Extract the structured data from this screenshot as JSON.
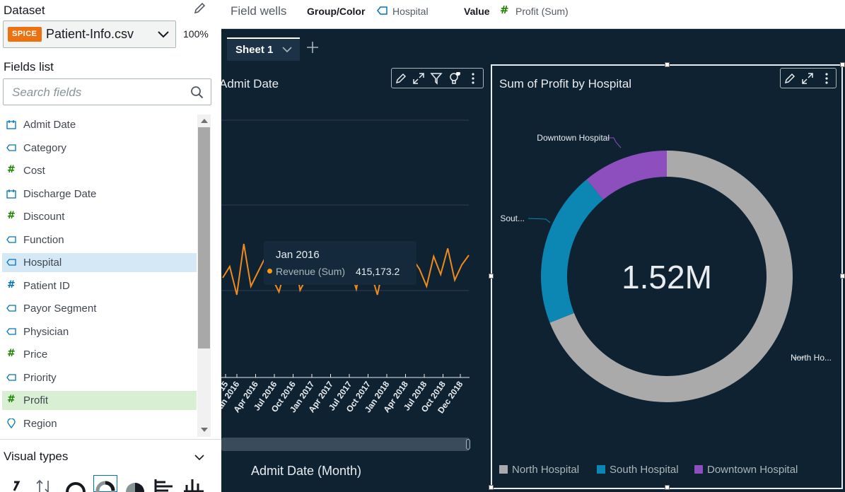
{
  "dataset": {
    "label": "Dataset",
    "badge": "SPICE",
    "name": "Patient-Info.csv",
    "percent": "100%"
  },
  "fields_list": {
    "label": "Fields list",
    "search_placeholder": "Search fields",
    "items": [
      {
        "label": "Admit Date",
        "type": "date"
      },
      {
        "label": "Category",
        "type": "dimension"
      },
      {
        "label": "Cost",
        "type": "measure"
      },
      {
        "label": "Discharge Date",
        "type": "date"
      },
      {
        "label": "Discount",
        "type": "measure"
      },
      {
        "label": "Function",
        "type": "dimension"
      },
      {
        "label": "Hospital",
        "type": "dimension"
      },
      {
        "label": "Patient ID",
        "type": "measure-id"
      },
      {
        "label": "Payor Segment",
        "type": "dimension"
      },
      {
        "label": "Physician",
        "type": "dimension"
      },
      {
        "label": "Price",
        "type": "measure"
      },
      {
        "label": "Priority",
        "type": "dimension"
      },
      {
        "label": "Profit",
        "type": "measure"
      },
      {
        "label": "Region",
        "type": "geo"
      }
    ]
  },
  "visual_types": {
    "label": "Visual types"
  },
  "field_wells": {
    "title": "Field wells",
    "group_color_label": "Group/Color",
    "group_color_value": "Hospital",
    "value_label": "Value",
    "value_value": "Profit (Sum)"
  },
  "sheet": {
    "tab_label": "Sheet 1"
  },
  "line_visual": {
    "title": "Admit Date",
    "x_axis_title": "Admit Date (Month)",
    "x_tick_labels": [
      "15",
      "Jan 2016",
      "Apr 2016",
      "Jul 2016",
      "Oct 2016",
      "Jan 2017",
      "Apr 2017",
      "Jul 2017",
      "Oct 2017",
      "Jan 2018",
      "Apr 2018",
      "Jul 2018",
      "Oct 2018",
      "Dec 2018"
    ],
    "tooltip": {
      "date": "Jan 2016",
      "series": "Revenue (Sum)",
      "value": "415,173.2"
    }
  },
  "donut_visual": {
    "title": "Sum of Profit by Hospital",
    "center_value": "1.52M",
    "slice_labels": [
      "Downtown Hospital",
      "Sout...",
      "North Ho..."
    ],
    "legend": [
      "North Hospital",
      "South Hospital",
      "Downtown Hospital"
    ]
  },
  "colors": {
    "north": "#aaaaaa",
    "south": "#0c86b3",
    "downtown": "#8e4fbe",
    "line": "#ef8a1e",
    "canvas": "#0f2232"
  },
  "chart_data": [
    {
      "type": "pie",
      "title": "Sum of Profit by Hospital",
      "categories": [
        "North Hospital",
        "South Hospital",
        "Downtown Hospital"
      ],
      "values": [
        0.69,
        0.2,
        0.11
      ],
      "center_label": "1.52M",
      "legend": "bottom"
    },
    {
      "type": "line",
      "title": "Admit Date",
      "xlabel": "Admit Date (Month)",
      "series": [
        {
          "name": "Revenue (Sum)",
          "values": [
            360,
            380,
            330,
            420,
            345,
            370,
            395,
            360,
            335,
            380,
            410,
            338,
            362,
            405,
            355,
            390,
            418,
            355,
            380,
            340,
            400,
            372,
            330,
            388,
            365,
            410,
            352,
            394,
            375,
            345,
            398,
            366,
            412,
            356,
            383,
            400
          ]
        }
      ]
    }
  ]
}
